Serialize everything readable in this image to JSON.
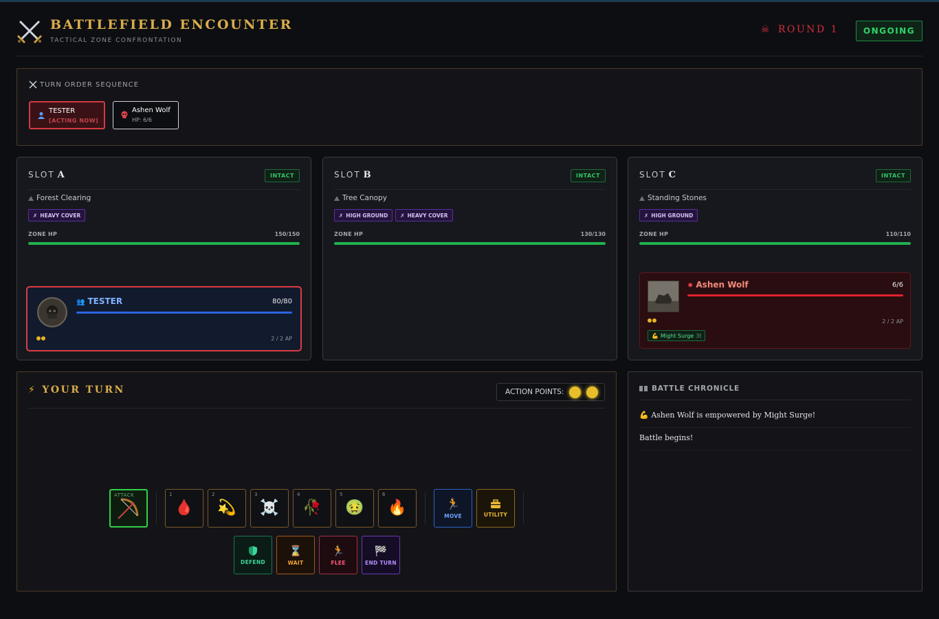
{
  "header": {
    "title": "BATTLEFIELD ENCOUNTER",
    "subtitle": "TACTICAL ZONE CONFRONTATION",
    "round": "ROUND 1",
    "status": "ONGOING"
  },
  "turn_order": {
    "heading": "TURN ORDER SEQUENCE",
    "entries": [
      {
        "name": "TESTER",
        "sub": "[ACTING NOW]"
      },
      {
        "name": "Ashen Wolf",
        "sub": "HP: 6/6"
      }
    ]
  },
  "slots": [
    {
      "title": "SLOT",
      "letter": "A",
      "state": "INTACT",
      "terrain": "Forest Clearing",
      "tags": [
        "HEAVY COVER"
      ],
      "zone_hp_label": "ZONE HP",
      "zone_hp": "150/150",
      "zone_hp_fraction": 1.0
    },
    {
      "title": "SLOT",
      "letter": "B",
      "state": "INTACT",
      "terrain": "Tree Canopy",
      "tags": [
        "HIGH GROUND",
        "HEAVY COVER"
      ],
      "zone_hp_label": "ZONE HP",
      "zone_hp": "130/130",
      "zone_hp_fraction": 1.0
    },
    {
      "title": "SLOT",
      "letter": "C",
      "state": "INTACT",
      "terrain": "Standing Stones",
      "tags": [
        "HIGH GROUND"
      ],
      "zone_hp_label": "ZONE HP",
      "zone_hp": "110/110",
      "zone_hp_fraction": 1.0
    }
  ],
  "units": {
    "player": {
      "name": "TESTER",
      "hp": "80/80",
      "hp_fraction": 1.0,
      "ap": "2 / 2 AP",
      "ap_dots": 2
    },
    "enemy": {
      "name": "Ashen Wolf",
      "hp": "6/6",
      "hp_fraction": 1.0,
      "ap": "2 / 2 AP",
      "ap_dots": 2,
      "buff": "Might Surge",
      "buff_duration": "3t"
    }
  },
  "action_panel": {
    "title": "YOUR TURN",
    "ap_label": "ACTION POINTS:",
    "ap_available": 2,
    "attack_label": "ATTACK",
    "skills": [
      {
        "num": "1",
        "glyph": "🩸"
      },
      {
        "num": "2",
        "glyph": "💫"
      },
      {
        "num": "3",
        "glyph": "☠️"
      },
      {
        "num": "4",
        "glyph": "🥀"
      },
      {
        "num": "5",
        "glyph": "🤢"
      },
      {
        "num": "6",
        "glyph": "🔥"
      }
    ],
    "buttons": {
      "move": "MOVE",
      "utility": "UTILITY",
      "defend": "DEFEND",
      "wait": "WAIT",
      "flee": "FLEE",
      "end_turn": "END TURN"
    }
  },
  "chronicle": {
    "title": "BATTLE CHRONICLE",
    "entries": [
      "💪 Ashen Wolf is empowered by Might Surge!",
      "Battle begins!"
    ]
  },
  "colors": {
    "gold": "#d9ad4b",
    "red": "#d22f3a",
    "green": "#2fd46a",
    "blue": "#2b66e0"
  }
}
